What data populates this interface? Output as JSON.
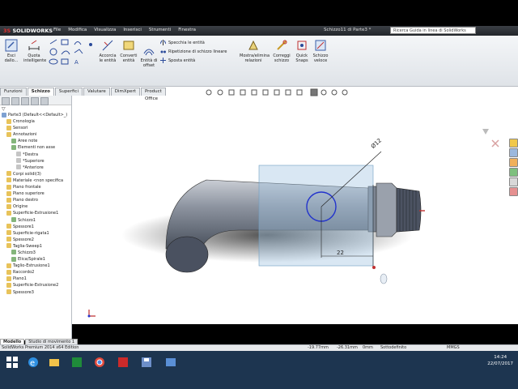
{
  "titlebar": {
    "logo": "SOLIDWORKS",
    "menu": [
      "File",
      "Modifica",
      "Visualizza",
      "Inserisci",
      "Strumenti",
      "Finestra"
    ],
    "doc_title": "Schizzo11 di Parte3 *",
    "search_placeholder": "Ricerca Guida in linea di SolidWorks"
  },
  "ribbon": {
    "exit_sketch": "Esci dallo...",
    "smart_dim": "Quota intelligente",
    "trim": "Accorcia le entità",
    "convert": "Converti entità",
    "offset": "Entità di offset",
    "mirror": "Specchia le entità",
    "linear_pattern": "Ripetizione di schizzo lineare",
    "move": "Sposta entità",
    "show_relations": "Mostra/elimina relazioni",
    "repair": "Correggi schizzo",
    "quick_snaps": "Quick Snaps",
    "rapid_sketch": "Schizzo veloce"
  },
  "tabs": [
    "Funzioni",
    "Schizzo",
    "Superfici",
    "Valutare",
    "DimXpert",
    "Product Office"
  ],
  "active_tab": "Schizzo",
  "tree": [
    {
      "label": "Parte3 (Default<<Default>_)",
      "depth": 0
    },
    {
      "label": "Cronologia",
      "depth": 1
    },
    {
      "label": "Sensori",
      "depth": 1
    },
    {
      "label": "Annotazioni",
      "depth": 1
    },
    {
      "label": "Aree note",
      "depth": 2
    },
    {
      "label": "Elementi non asse",
      "depth": 2
    },
    {
      "label": "*Destra",
      "depth": 3
    },
    {
      "label": "*Superiore",
      "depth": 3
    },
    {
      "label": "*Anteriore",
      "depth": 3
    },
    {
      "label": "Corpi solidi(3)",
      "depth": 1
    },
    {
      "label": "Materiale <non specifica",
      "depth": 1
    },
    {
      "label": "Piano frontale",
      "depth": 1
    },
    {
      "label": "Piano superiore",
      "depth": 1
    },
    {
      "label": "Piano destro",
      "depth": 1
    },
    {
      "label": "Origine",
      "depth": 1
    },
    {
      "label": "Superficie-Estrusione1",
      "depth": 1
    },
    {
      "label": "Schizzo1",
      "depth": 2
    },
    {
      "label": "Spessore1",
      "depth": 1
    },
    {
      "label": "Superficie-rigata1",
      "depth": 1
    },
    {
      "label": "Spessore2",
      "depth": 1
    },
    {
      "label": "Taglia-Sweep1",
      "depth": 1
    },
    {
      "label": "Schizzo3",
      "depth": 2
    },
    {
      "label": "Elica/Spirale1",
      "depth": 2
    },
    {
      "label": "Taglio-Estrusione1",
      "depth": 1
    },
    {
      "label": "Raccordo2",
      "depth": 1
    },
    {
      "label": "Piano1",
      "depth": 1
    },
    {
      "label": "Superficie-Estrusione2",
      "depth": 1
    },
    {
      "label": "Spessore3",
      "depth": 1
    }
  ],
  "bottom_tabs": [
    "Modello",
    "Studio di movimento 1"
  ],
  "sketch": {
    "diameter_label": "Ø12",
    "length_label": "22"
  },
  "status": {
    "edition": "SolidWorks Premium 2014 x64 Edition",
    "x": "-19.77mm",
    "y": "-26.31mm",
    "z": "0mm",
    "state": "Sottodefinito",
    "units": "MMGS"
  },
  "clock": {
    "time": "14:24",
    "date": "22/07/2017"
  },
  "colors": {
    "sketch": "#2233cc",
    "titlebar": "#2b2f35",
    "taskbar": "#1d3550",
    "accent": "#e03030"
  }
}
